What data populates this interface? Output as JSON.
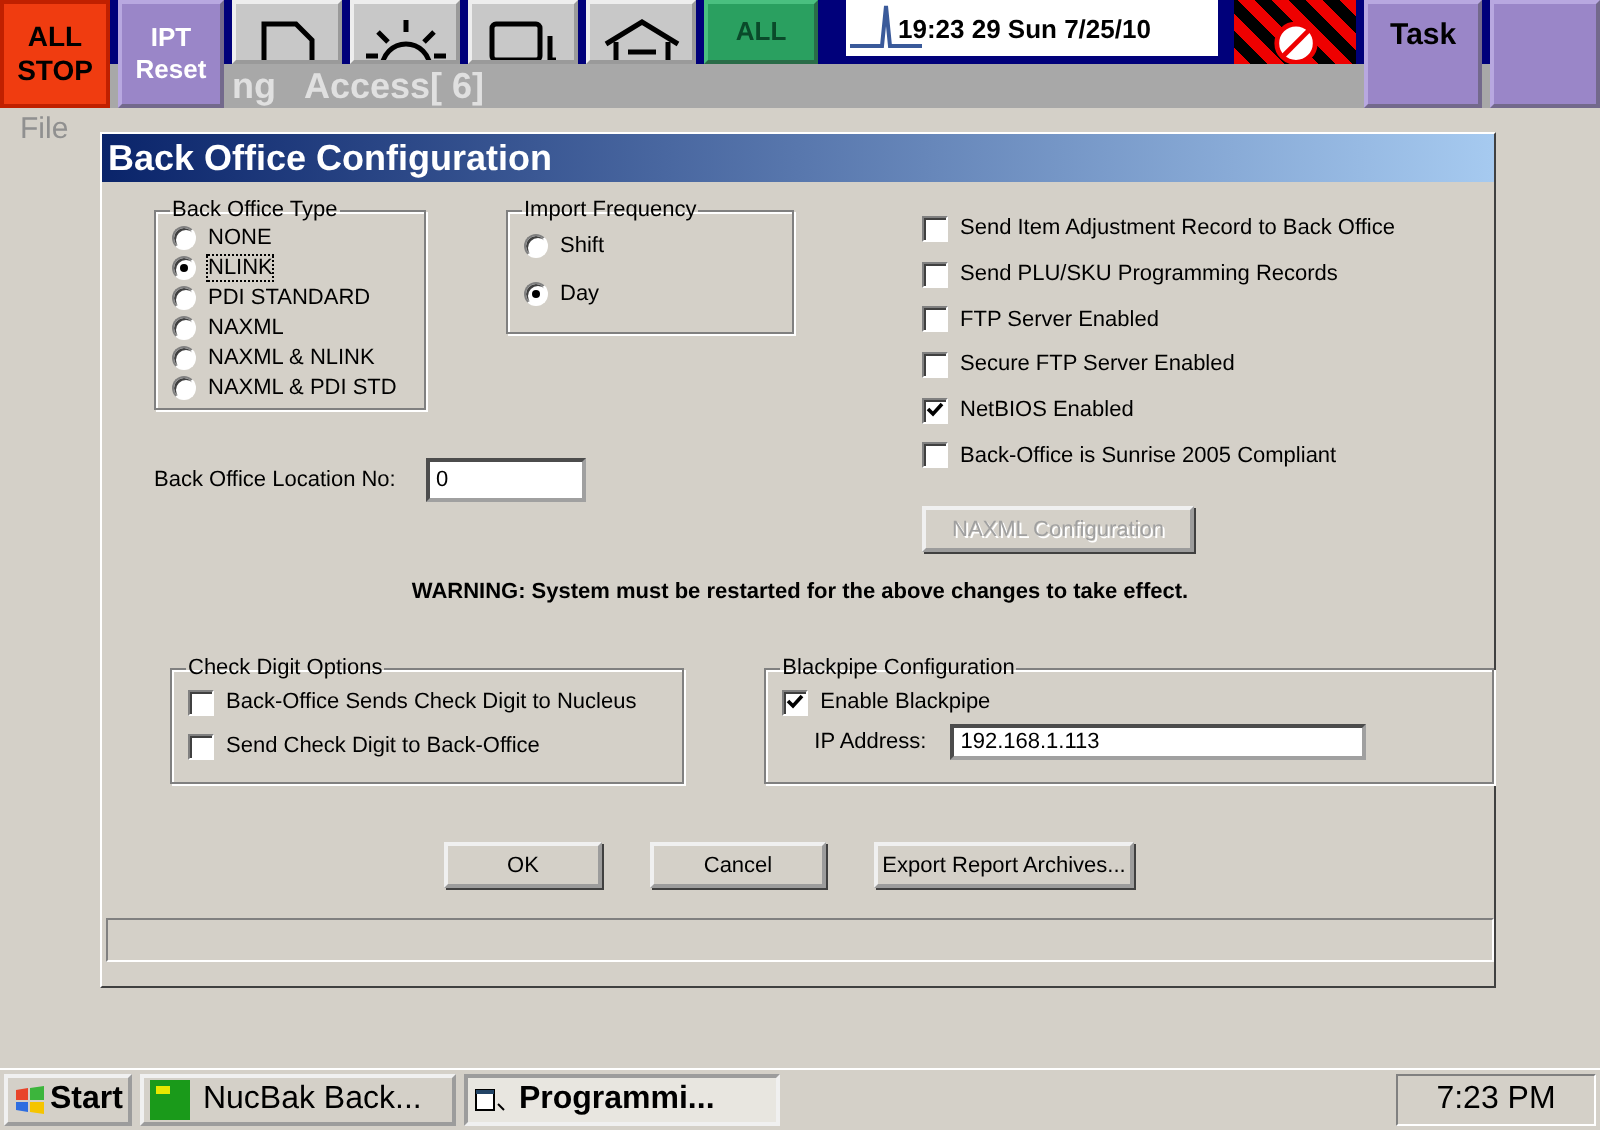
{
  "toolbar": [
    {
      "kind": "stop",
      "lines": [
        "ALL",
        "STOP"
      ]
    },
    {
      "kind": "reset",
      "lines": [
        "IPT",
        "Reset"
      ]
    },
    {
      "kind": "page"
    },
    {
      "kind": "sun"
    },
    {
      "kind": "device"
    },
    {
      "kind": "house"
    },
    {
      "kind": "start",
      "lines": [
        "ALL"
      ]
    },
    {
      "kind": "clock",
      "lines": [
        "19:23 29 Sun 7/25/10"
      ]
    },
    {
      "kind": "forbidden"
    },
    {
      "kind": "task",
      "lines": [
        "Task"
      ]
    },
    {
      "kind": "help"
    }
  ],
  "background_window": {
    "title_parts": [
      "ng",
      "Access[ 6]"
    ],
    "menu": [
      "File"
    ]
  },
  "dialog": {
    "title": "Back Office Configuration",
    "back_office_type": {
      "label": "Back Office Type",
      "options": [
        {
          "label": "NONE",
          "selected": false
        },
        {
          "label": "NLINK",
          "selected": true
        },
        {
          "label": "PDI STANDARD",
          "selected": false
        },
        {
          "label": "NAXML",
          "selected": false
        },
        {
          "label": "NAXML & NLINK",
          "selected": false
        },
        {
          "label": "NAXML & PDI STD",
          "selected": false
        }
      ]
    },
    "import_frequency": {
      "label": "Import Frequency",
      "options": [
        {
          "label": "Shift",
          "selected": false
        },
        {
          "label": "Day",
          "selected": true
        }
      ]
    },
    "location": {
      "label": "Back Office Location No:",
      "value": "0"
    },
    "checkboxes": [
      {
        "label": "Send Item Adjustment Record to Back Office",
        "checked": false
      },
      {
        "label": "Send PLU/SKU Programming Records",
        "checked": false
      },
      {
        "label": "FTP Server Enabled",
        "checked": false
      },
      {
        "label": "Secure FTP Server Enabled",
        "checked": false
      },
      {
        "label": "NetBIOS Enabled",
        "checked": true
      },
      {
        "label": "Back-Office is Sunrise 2005 Compliant",
        "checked": false
      }
    ],
    "naxml_button": {
      "label": "NAXML Configuration",
      "disabled": true
    },
    "warning": "WARNING: System must be restarted for the above changes to take effect.",
    "check_digit": {
      "label": "Check Digit Options",
      "options": [
        {
          "label": "Back-Office Sends Check Digit to Nucleus",
          "checked": false
        },
        {
          "label": "Send Check Digit to Back-Office",
          "checked": false
        }
      ]
    },
    "blackpipe": {
      "label": "Blackpipe Configuration",
      "enable": {
        "label": "Enable Blackpipe",
        "checked": true
      },
      "ip": {
        "label": "IP Address:",
        "value": "192.168.1.113"
      }
    },
    "buttons": [
      "OK",
      "Cancel",
      "Export Report Archives..."
    ]
  },
  "taskbar": {
    "start": "Start",
    "tasks": [
      {
        "label": "NucBak Back...",
        "kind": "nb",
        "selected": false
      },
      {
        "label": "Programmi...",
        "kind": "folder",
        "selected": true
      }
    ],
    "clock": "7:23 PM"
  }
}
